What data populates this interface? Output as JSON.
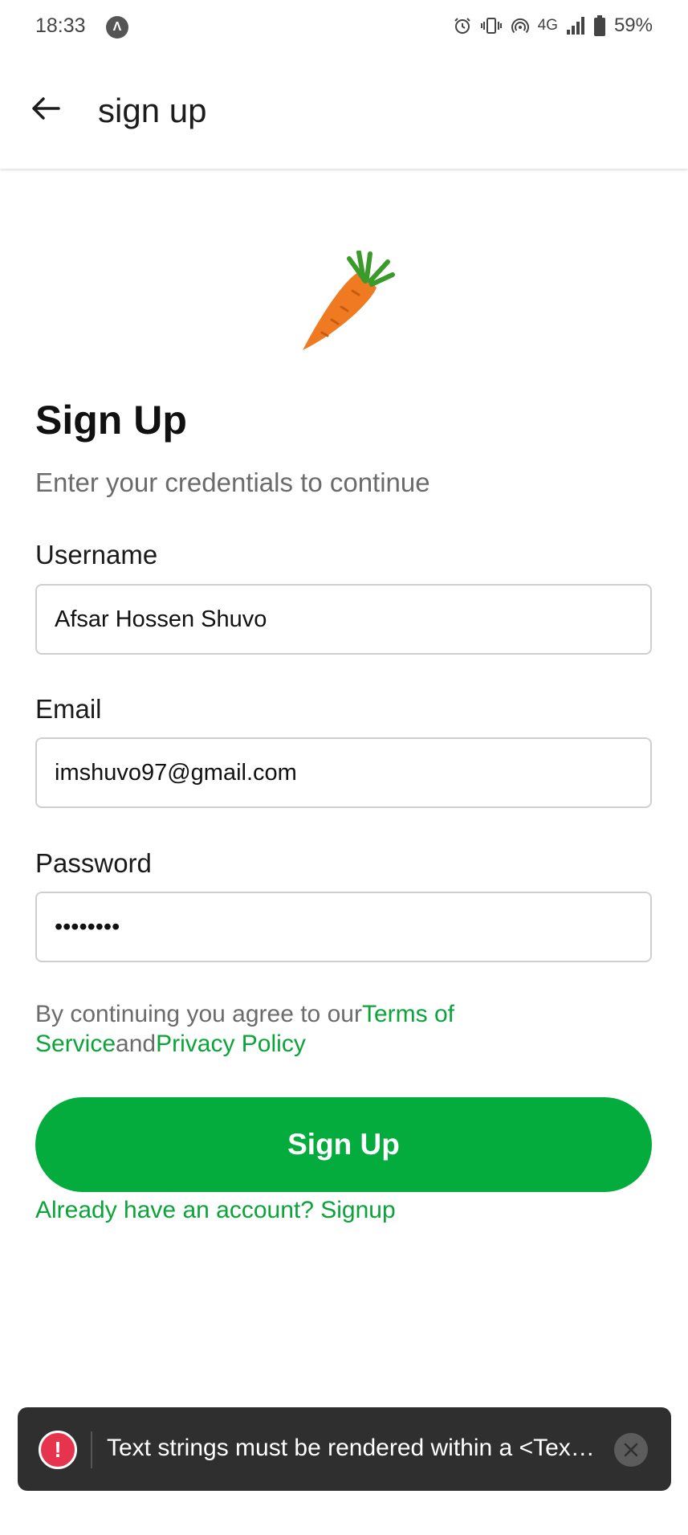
{
  "status_bar": {
    "time": "18:33",
    "app_icon_glyph": "Λ",
    "network": "4G",
    "battery": "59%"
  },
  "appbar": {
    "title": "sign up",
    "back_icon": "arrow-left-icon"
  },
  "logo": {
    "icon": "carrot-icon",
    "colors": {
      "body": "#f07a21",
      "leaves": "#3a9a2a"
    }
  },
  "form": {
    "title": "Sign Up",
    "subtitle": "Enter your credentials to continue",
    "username": {
      "label": "Username",
      "value": "Afsar Hossen Shuvo"
    },
    "email": {
      "label": "Email",
      "value": "imshuvo97@gmail.com"
    },
    "password": {
      "label": "Password",
      "value": "••••••••"
    }
  },
  "terms": {
    "prefix": "By continuing you agree to our",
    "terms_link": "Terms of Service",
    "connector": "and",
    "privacy_link": "Privacy Policy"
  },
  "actions": {
    "signup_label": "Sign Up",
    "already_label": "Already have an account? Signup"
  },
  "toast": {
    "message": "Text strings must be rendered within a <Tex…",
    "icon": "exclamation-icon",
    "close_icon": "close-icon"
  },
  "colors": {
    "accent": "#03ac3c",
    "link": "#0aa43a",
    "toast_bg": "#2f2f2f",
    "error": "#e6344f"
  }
}
